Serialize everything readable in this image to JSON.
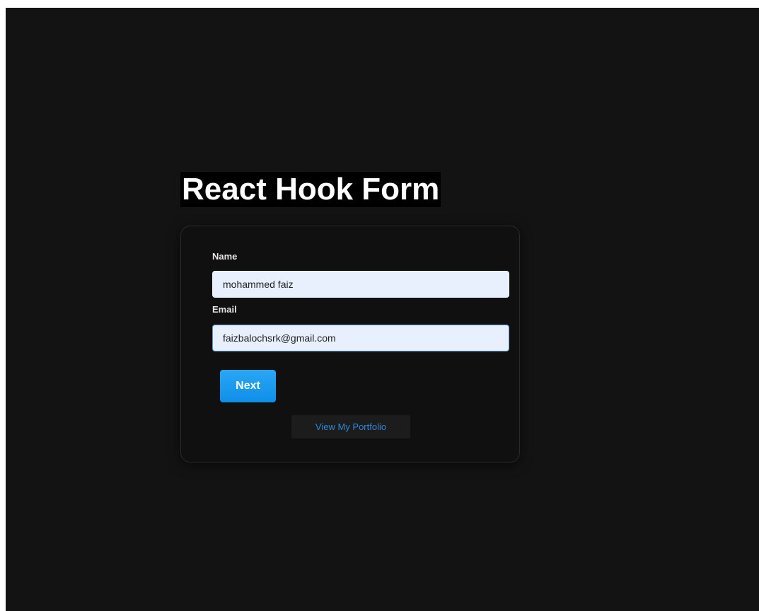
{
  "page": {
    "title": "React Hook Form"
  },
  "form": {
    "name_label": "Name",
    "name_value": "mohammed faiz",
    "email_label": "Email",
    "email_value": "faizbalochsrk@gmail.com",
    "next_label": "Next",
    "portfolio_label": "View My Portfolio"
  },
  "colors": {
    "background": "#131313",
    "card": "#101010",
    "input_fill": "#e8f0fe",
    "button": "#1a9bef",
    "link": "#2f86d8"
  }
}
